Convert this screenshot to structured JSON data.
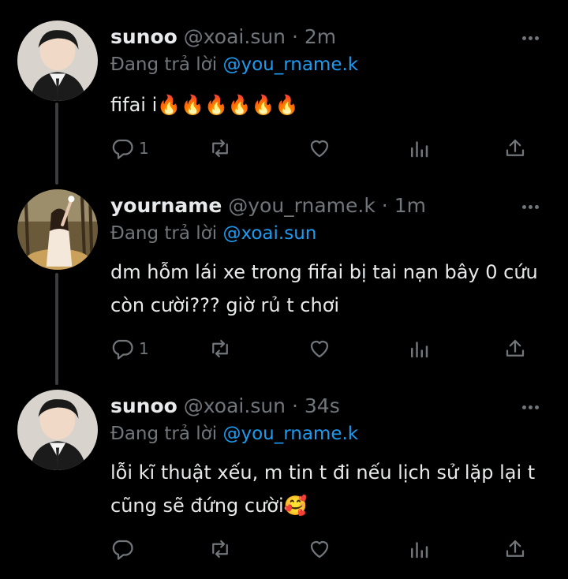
{
  "tweets": [
    {
      "name": "sunoo",
      "handle": "@xoai.sun",
      "separator": "·",
      "time": "2m",
      "reply_prefix": "Đang trả lời ",
      "reply_to": "@you_rname.k",
      "text": "fifai i🔥🔥🔥🔥🔥🔥",
      "reply_count": "1",
      "avatar": "boy-portrait"
    },
    {
      "name": "yourname",
      "handle": "@you_rname.k",
      "separator": "·",
      "time": "1m",
      "reply_prefix": "Đang trả lời ",
      "reply_to": "@xoai.sun",
      "text": "dm hỗm lái xe trong fifai bị tai nạn bây 0 cứu còn cười??? giờ rủ t chơi",
      "reply_count": "1",
      "avatar": "girl-forest"
    },
    {
      "name": "sunoo",
      "handle": "@xoai.sun",
      "separator": "·",
      "time": "34s",
      "reply_prefix": "Đang trả lời ",
      "reply_to": "@you_rname.k",
      "text": "lỗi kĩ thuật xếu, m tin t đi nếu lịch sử lặp lại t cũng sẽ đứng cười🥰",
      "reply_count": "",
      "avatar": "boy-portrait"
    }
  ],
  "icons": [
    "reply-icon",
    "retweet-icon",
    "like-icon",
    "views-icon",
    "share-icon",
    "more-icon"
  ],
  "colors": {
    "background": "#000000",
    "text": "#e7e9ea",
    "muted": "#71767b",
    "link": "#1d9bf0",
    "thread": "#3a3d40"
  }
}
